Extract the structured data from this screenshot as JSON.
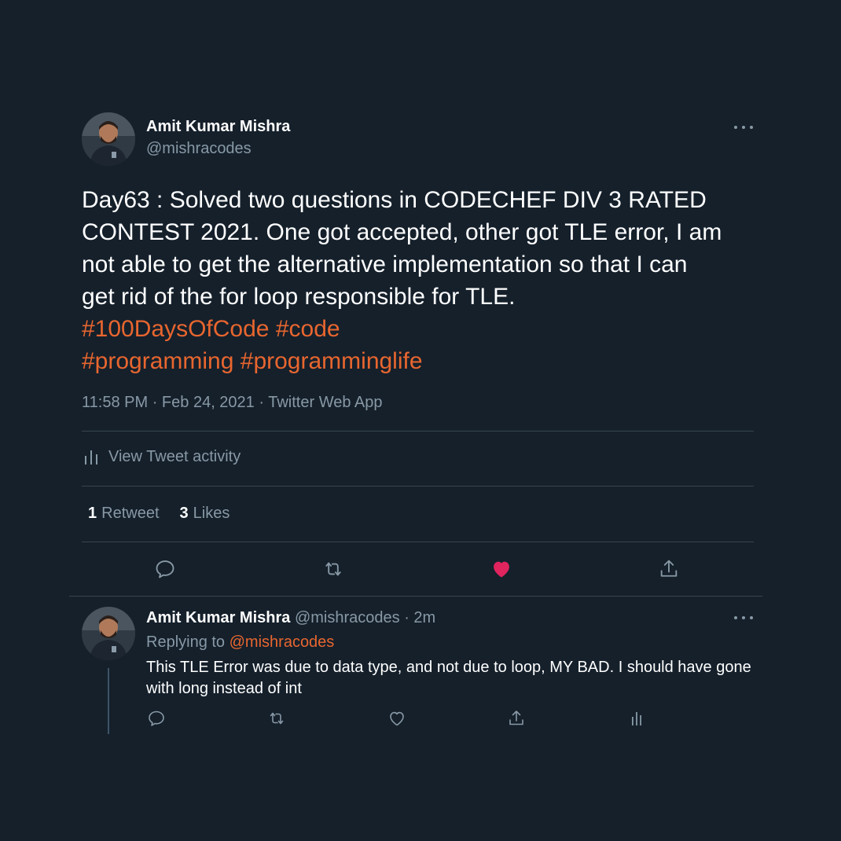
{
  "main_tweet": {
    "author_name": "Amit Kumar Mishra",
    "author_handle": "@mishracodes",
    "text_lines": [
      "Day63 : Solved two questions in CODECHEF DIV 3 RATED",
      "CONTEST 2021. One got accepted, other got TLE error, I am",
      "not able to get the alternative implementation so that I can",
      "get rid of the for loop responsible for TLE."
    ],
    "hashtags_line1": [
      "#100DaysOfCode",
      "#code"
    ],
    "hashtags_line2": [
      "#programming",
      "#programminglife"
    ],
    "time": "11:58 PM",
    "date": "Feb 24, 2021",
    "source": "Twitter Web App",
    "view_activity_label": "View Tweet activity",
    "retweet_count": "1",
    "retweet_label": "Retweet",
    "like_count": "3",
    "like_label": "Likes",
    "liked": true,
    "actions": [
      "reply-icon",
      "retweet-icon",
      "like-icon",
      "share-icon"
    ]
  },
  "reply": {
    "author_name": "Amit Kumar Mishra",
    "author_handle": "@mishracodes",
    "separator": "·",
    "time": "2m",
    "replying_to_label": "Replying to",
    "replying_to_handle": "@mishracodes",
    "text": "This TLE Error was due to data type, and not due to loop, MY BAD. I should have gone with long instead of int",
    "actions": [
      "reply-icon",
      "retweet-icon",
      "like-icon",
      "share-icon",
      "analytics-icon"
    ]
  },
  "meta_separator": "·",
  "colors": {
    "background": "#15202b",
    "secondary_text": "#8899a6",
    "accent": "#e8662f",
    "like": "#e0245e",
    "divider": "#38444d"
  }
}
